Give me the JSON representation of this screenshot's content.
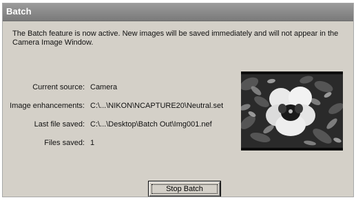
{
  "window": {
    "title": "Batch"
  },
  "message": "The Batch feature is now active.  New images will be saved immediately and will not appear in the Camera Image Window.",
  "info": {
    "current_source_label": "Current source:",
    "current_source_value": "Camera",
    "enhancements_label": "Image enhancements:",
    "enhancements_value": "C:\\...\\NIKON\\NCAPTURE20\\Neutral.set",
    "last_file_label": "Last file saved:",
    "last_file_value": "C:\\...\\Desktop\\Batch Out\\Img001.nef",
    "files_saved_label": "Files saved:",
    "files_saved_value": "1"
  },
  "preview": {
    "subject": "pansy-flower-photo"
  },
  "buttons": {
    "stop_batch": "Stop Batch"
  },
  "colors": {
    "dialog_bg": "#d4d0c8",
    "titlebar": "#8a8a8a",
    "title_text": "#ffffff"
  }
}
